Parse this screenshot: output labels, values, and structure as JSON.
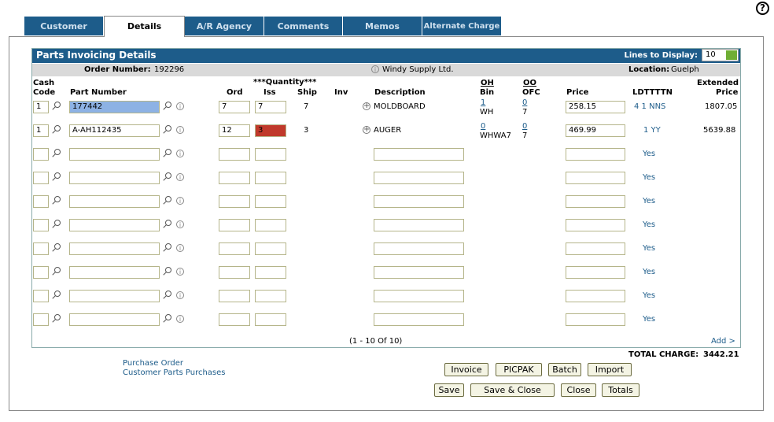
{
  "help_label": "?",
  "tabs": [
    {
      "label": "Customer"
    },
    {
      "label": "Details"
    },
    {
      "label": "A/R Agency"
    },
    {
      "label": "Comments"
    },
    {
      "label": "Memos"
    },
    {
      "label": "Alternate Charge"
    }
  ],
  "panel": {
    "title": "Parts Invoicing Details",
    "lines_label": "Lines to Display:",
    "lines_value": "10"
  },
  "order": {
    "number_label": "Order Number:",
    "number": "192296",
    "customer": "Windy Supply Ltd.",
    "location_label": "Location:",
    "location": "Guelph"
  },
  "headers": {
    "cash": "Cash",
    "code": "Code",
    "part_number": "Part Number",
    "quantity": "***Quantity***",
    "ord": "Ord",
    "iss": "Iss",
    "ship": "Ship",
    "inv": "Inv",
    "description": "Description",
    "oh": "OH",
    "bin": "Bin",
    "oo": "OO",
    "ofc": "OFC",
    "price": "Price",
    "ldtttn": "LDTTTTN",
    "extended": "Extended",
    "ext_price": "Price"
  },
  "rows": [
    {
      "cash": "1",
      "part": "177442",
      "ord": "7",
      "iss": "7",
      "ship": "7",
      "desc": "MOLDBOARD",
      "oh": "1",
      "bin": "WH",
      "oo": "0",
      "ofc": "7",
      "price": "258.15",
      "ldt": "4 1 NNS",
      "ext": "1807.05"
    },
    {
      "cash": "1",
      "part": "A-AH112435",
      "ord": "12",
      "iss": "3",
      "ship": "3",
      "desc": "AUGER",
      "oh": "0",
      "bin": "WHWA7",
      "oo": "0",
      "ofc": "7",
      "price": "469.99",
      "ldt": "1 YY",
      "ext": "5639.88"
    },
    {
      "ldt": "Yes"
    },
    {
      "ldt": "Yes"
    },
    {
      "ldt": "Yes"
    },
    {
      "ldt": "Yes"
    },
    {
      "ldt": "Yes"
    },
    {
      "ldt": "Yes"
    },
    {
      "ldt": "Yes"
    },
    {
      "ldt": "Yes"
    }
  ],
  "pagination": "(1 - 10 Of 10)",
  "add_link": "Add >",
  "total_label": "TOTAL CHARGE:",
  "total_value": "3442.21",
  "links": {
    "purchase_order": "Purchase Order",
    "customer_parts": "Customer Parts Purchases"
  },
  "buttons": {
    "invoice": "Invoice",
    "picpak": "PICPAK",
    "batch": "Batch",
    "import": "Import",
    "save": "Save",
    "save_close": "Save & Close",
    "close": "Close",
    "totals": "Totals"
  },
  "colors": {
    "tab_bg": "#1d5c8a",
    "accent_green": "#6fae34",
    "issue_red": "#c0392b",
    "selected_blue": "#8db2e4"
  }
}
